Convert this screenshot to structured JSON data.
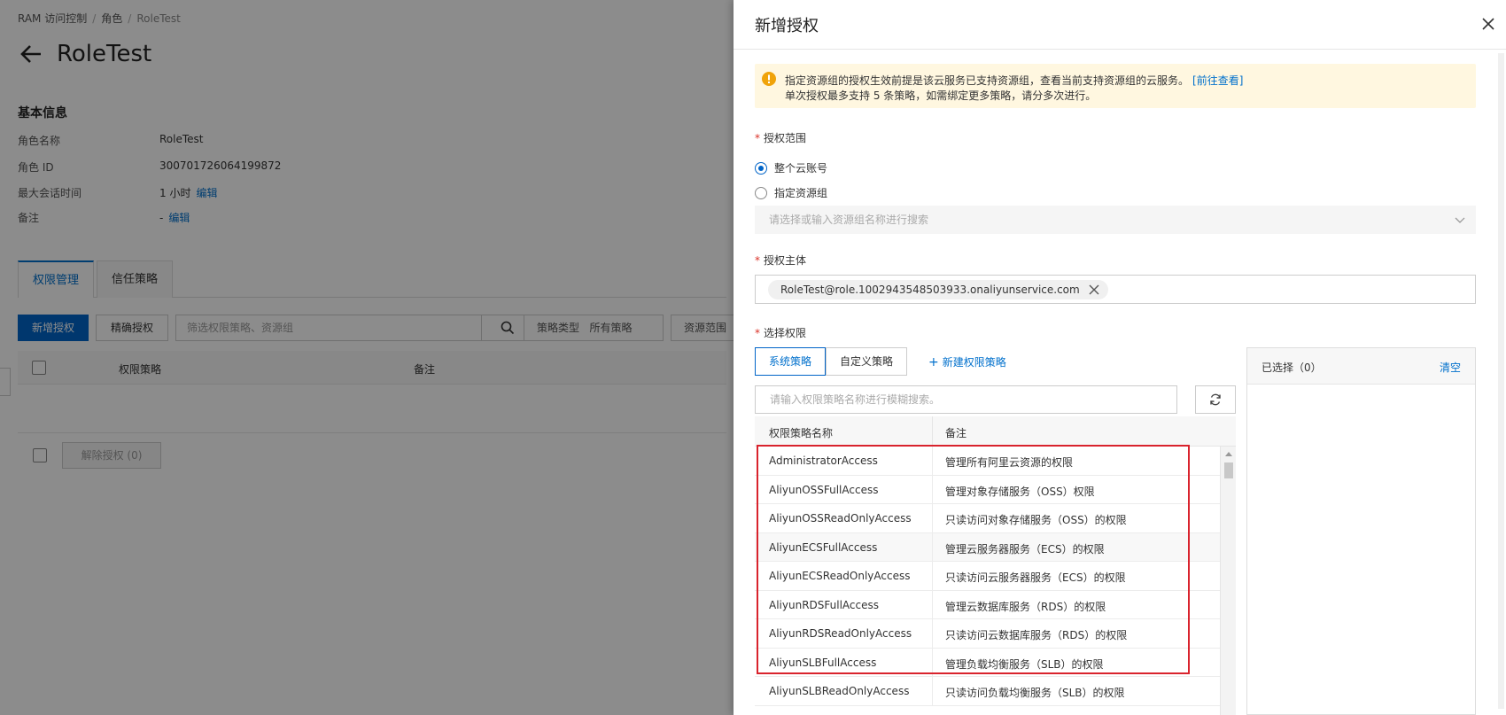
{
  "breadcrumb": [
    "RAM 访问控制",
    "角色",
    "RoleTest"
  ],
  "page": {
    "title": "RoleTest",
    "basic_info_title": "基本信息",
    "info": [
      {
        "label": "角色名称",
        "value": "RoleTest",
        "link": ""
      },
      {
        "label": "角色 ID",
        "value": "300701726064199872",
        "link": ""
      },
      {
        "label": "最大会话时间",
        "value": "1 小时",
        "link": "编辑"
      },
      {
        "label": "备注",
        "value": "-",
        "link": "编辑"
      }
    ],
    "tabs": [
      "权限管理",
      "信任策略"
    ],
    "toolbar": {
      "add_button": "新增授权",
      "precise_button": "精确授权",
      "filter_placeholder": "筛选权限策略、资源组",
      "policy_type_label": "策略类型",
      "policy_type_value": "所有策略",
      "scope_label": "资源范围"
    },
    "table_head": {
      "policy": "权限策略",
      "note": "备注"
    },
    "revoke_button": "解除授权 (0)"
  },
  "drawer": {
    "title": "新增授权",
    "alert": {
      "line1": "指定资源组的授权生效前提是该云服务已支持资源组，查看当前支持资源组的云服务。",
      "link": "[前往查看]",
      "line2": "单次授权最多支持 5 条策略，如需绑定更多策略，请分多次进行。"
    },
    "scope_label": "授权范围",
    "scope_options": [
      "整个云账号",
      "指定资源组"
    ],
    "resource_group_placeholder": "请选择或输入资源组名称进行搜索",
    "principal_label": "授权主体",
    "principal_tag": "RoleTest@role.1002943548503933.onaliyunservice.com",
    "permission_label": "选择权限",
    "policy_tabs": [
      "系统策略",
      "自定义策略"
    ],
    "new_policy_link": "新建权限策略",
    "policy_search_placeholder": "请输入权限策略名称进行模糊搜索。",
    "policy_table_head": {
      "name": "权限策略名称",
      "note": "备注"
    },
    "policies": [
      {
        "name": "AdministratorAccess",
        "note": "管理所有阿里云资源的权限"
      },
      {
        "name": "AliyunOSSFullAccess",
        "note": "管理对象存储服务（OSS）权限"
      },
      {
        "name": "AliyunOSSReadOnlyAccess",
        "note": "只读访问对象存储服务（OSS）的权限"
      },
      {
        "name": "AliyunECSFullAccess",
        "note": "管理云服务器服务（ECS）的权限"
      },
      {
        "name": "AliyunECSReadOnlyAccess",
        "note": "只读访问云服务器服务（ECS）的权限"
      },
      {
        "name": "AliyunRDSFullAccess",
        "note": "管理云数据库服务（RDS）的权限"
      },
      {
        "name": "AliyunRDSReadOnlyAccess",
        "note": "只读访问云数据库服务（RDS）的权限"
      },
      {
        "name": "AliyunSLBFullAccess",
        "note": "管理负载均衡服务（SLB）的权限"
      },
      {
        "name": "AliyunSLBReadOnlyAccess",
        "note": "只读访问负载均衡服务（SLB）的权限"
      }
    ],
    "selected_title": "已选择（0）",
    "clear_link": "清空"
  },
  "colors": {
    "primary": "#0064c8",
    "link": "#0070cc",
    "alert_bg": "#fff7e0",
    "alert_icon": "#f0a30a",
    "highlight": "#d9232d",
    "required": "#d93026"
  },
  "icons": [
    "back-arrow-icon",
    "close-icon",
    "warning-icon",
    "chevron-down-icon",
    "tag-close-icon",
    "plus-icon",
    "refresh-icon",
    "search-icon",
    "scroll-up-icon"
  ]
}
